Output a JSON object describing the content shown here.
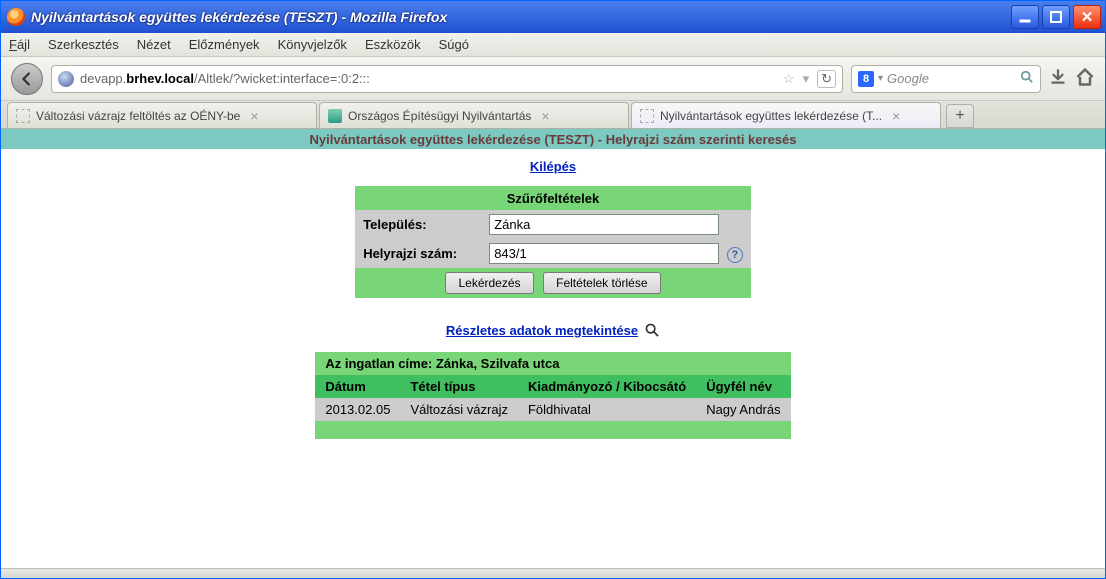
{
  "window_title": "Nyilvántartások együttes lekérdezése (TESZT) - Mozilla Firefox",
  "menu": {
    "file": "Fájl",
    "edit": "Szerkesztés",
    "view": "Nézet",
    "history": "Előzmények",
    "bookmarks": "Könyvjelzők",
    "tools": "Eszközök",
    "help": "Súgó"
  },
  "url": {
    "pre": "devapp.",
    "host": "brhev.local",
    "path": "/Altlek/?wicket:interface=:0:2:::"
  },
  "search": {
    "placeholder": "Google"
  },
  "tabs": [
    {
      "label": "Változási vázrajz feltöltés az OÉNY-be"
    },
    {
      "label": "Országos Építésügyi Nyilvántartás"
    },
    {
      "label": "Nyilvántartások együttes lekérdezése (T..."
    }
  ],
  "page_header": "Nyilvántartások együttes lekérdezése (TESZT) - Helyrajzi szám szerinti keresés",
  "logout_link": "Kilépés",
  "filter": {
    "title": "Szűrőfeltételek",
    "row1_label": "Település:",
    "row1_value": "Zánka",
    "row2_label": "Helyrajzi szám:",
    "row2_value": "843/1",
    "btn_query": "Lekérdezés",
    "btn_clear": "Feltételek törlése"
  },
  "details_link": "Részletes adatok megtekintése",
  "result": {
    "title": "Az ingatlan címe: Zánka, Szilvafa utca",
    "headers": {
      "date": "Dátum",
      "type": "Tétel típus",
      "issuer": "Kiadmányozó / Kibocsátó",
      "client": "Ügyfél név"
    },
    "row": {
      "date": "2013.02.05",
      "type": "Változási vázrajz",
      "issuer": "Földhivatal",
      "client": "Nagy András"
    }
  }
}
